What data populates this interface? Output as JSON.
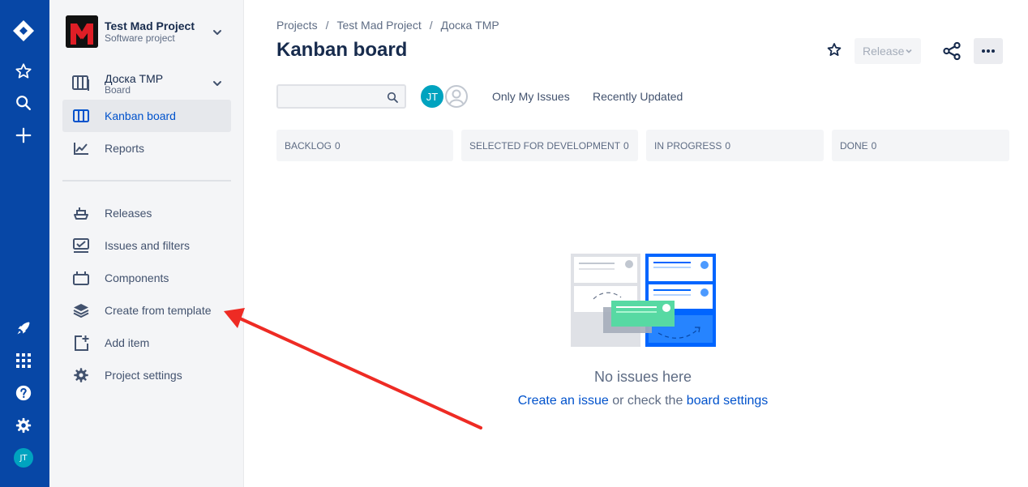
{
  "global_nav": {
    "avatar_initials": "JT",
    "icons": [
      "jira-logo-icon",
      "star-icon",
      "search-icon",
      "plus-icon",
      "rocket-icon",
      "app-grid-icon",
      "help-icon",
      "gear-icon"
    ]
  },
  "sidebar": {
    "project_name": "Test Mad Project",
    "project_type": "Software project",
    "board_name": "Доска TMP",
    "board_type": "Board",
    "items": [
      {
        "label": "Kanban board",
        "icon": "board-icon",
        "active": true
      },
      {
        "label": "Reports",
        "icon": "chart-icon",
        "active": false
      }
    ],
    "items2": [
      {
        "label": "Releases",
        "icon": "ship-icon"
      },
      {
        "label": "Issues and filters",
        "icon": "filter-list-icon"
      },
      {
        "label": "Components",
        "icon": "component-icon"
      },
      {
        "label": "Create from template",
        "icon": "stack-icon"
      },
      {
        "label": "Add item",
        "icon": "add-page-icon"
      },
      {
        "label": "Project settings",
        "icon": "gear-icon"
      }
    ]
  },
  "header": {
    "breadcrumbs": [
      "Projects",
      "Test Mad Project",
      "Доска TMP"
    ],
    "title": "Kanban board",
    "release_label": "Release"
  },
  "toolbar": {
    "search_value": "",
    "avatar_initials": "JT",
    "filters": [
      "Only My Issues",
      "Recently Updated"
    ]
  },
  "columns": [
    {
      "name": "BACKLOG",
      "count": "0"
    },
    {
      "name": "SELECTED FOR DEVELOPMENT",
      "count": "0"
    },
    {
      "name": "IN PROGRESS",
      "count": "0"
    },
    {
      "name": "DONE",
      "count": "0"
    }
  ],
  "empty_state": {
    "title": "No issues here",
    "link1": "Create an issue",
    "middle": " or check the ",
    "link2": "board settings"
  },
  "colors": {
    "nav_bg": "#0747a6",
    "accent": "#0052cc",
    "annotation_arrow": "#ee2b24"
  }
}
